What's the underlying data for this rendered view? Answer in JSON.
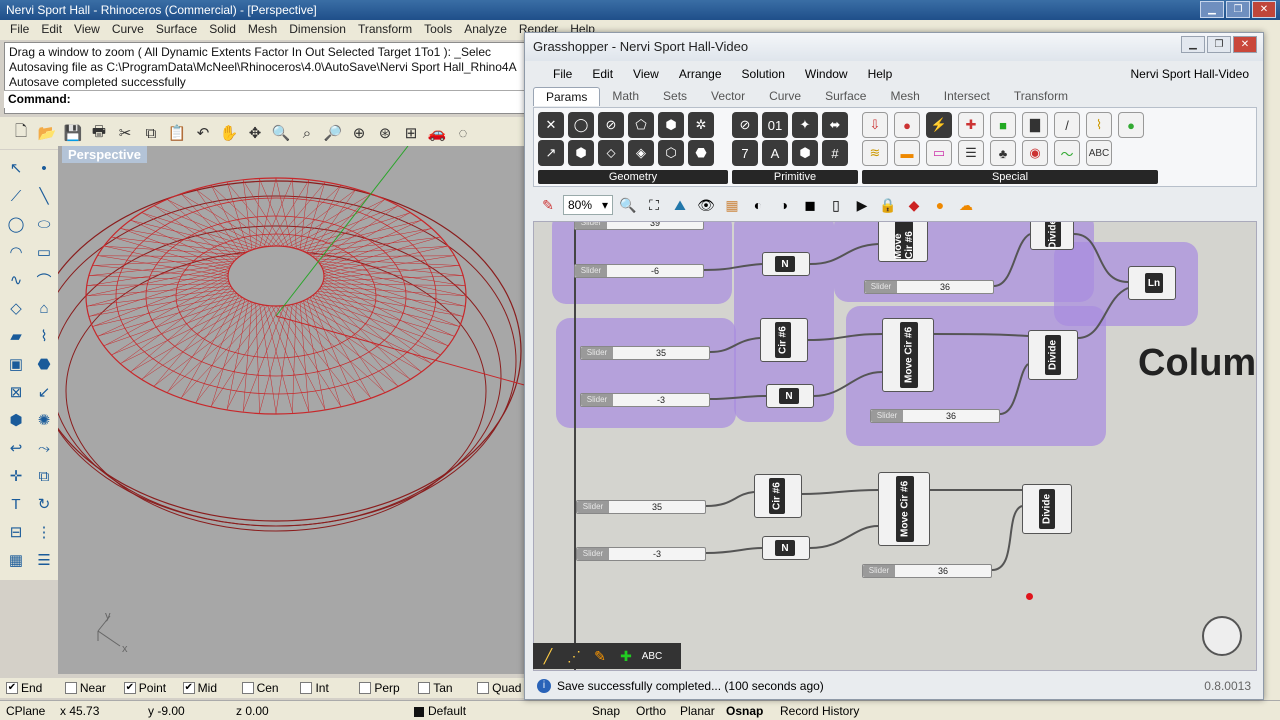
{
  "rhino": {
    "title": "Nervi Sport Hall - Rhinoceros (Commercial) - [Perspective]",
    "menu": [
      "File",
      "Edit",
      "View",
      "Curve",
      "Surface",
      "Solid",
      "Mesh",
      "Dimension",
      "Transform",
      "Tools",
      "Analyze",
      "Render",
      "Help"
    ],
    "history": [
      "Drag a window to zoom ( All  Dynamic  Extents  Factor  In  Out  Selected  Target  1To1 ): _Selec",
      "Autosaving file as C:\\ProgramData\\McNeel\\Rhinoceros\\4.0\\AutoSave\\Nervi Sport Hall_Rhino4A",
      "Autosave completed successfully"
    ],
    "command_label": "Command:",
    "viewport_label": "Perspective",
    "osnaps": [
      {
        "label": "End",
        "checked": true
      },
      {
        "label": "Near",
        "checked": false
      },
      {
        "label": "Point",
        "checked": true
      },
      {
        "label": "Mid",
        "checked": true
      },
      {
        "label": "Cen",
        "checked": false
      },
      {
        "label": "Int",
        "checked": false
      },
      {
        "label": "Perp",
        "checked": false
      },
      {
        "label": "Tan",
        "checked": false
      },
      {
        "label": "Quad",
        "checked": false
      }
    ],
    "status": {
      "cplane": "CPlane",
      "x": "x 45.73",
      "y": "y -9.00",
      "z": "z 0.00",
      "layer": "Default",
      "snap": "Snap",
      "ortho": "Ortho",
      "planar": "Planar",
      "osnap": "Osnap",
      "record_history": "Record History"
    }
  },
  "gh": {
    "title": "Grasshopper - Nervi Sport Hall-Video",
    "menu": [
      "File",
      "Edit",
      "View",
      "Arrange",
      "Solution",
      "Window",
      "Help"
    ],
    "doc_name": "Nervi Sport Hall-Video",
    "tabs": [
      "Params",
      "Math",
      "Sets",
      "Vector",
      "Curve",
      "Surface",
      "Mesh",
      "Intersect",
      "Transform"
    ],
    "active_tab": "Params",
    "panels": [
      "Geometry",
      "Primitive",
      "Special"
    ],
    "zoom": "80%",
    "canvas_text": "Colum",
    "slider_label": "Slider",
    "sliders": [
      "39",
      "-6",
      "36",
      "35",
      "-3",
      "36",
      "35",
      "-3",
      "36"
    ],
    "components": {
      "cir": "Cir #6",
      "move": "Move Cir #6",
      "divide": "Divide",
      "ln": "Ln",
      "neg": "N"
    },
    "status_text": "Save successfully completed... (100 seconds ago)",
    "version": "0.8.0013"
  }
}
